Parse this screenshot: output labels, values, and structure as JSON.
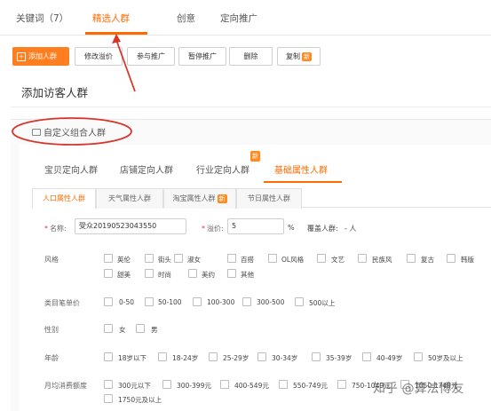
{
  "top_tabs": [
    {
      "label": "关键词（7）"
    },
    {
      "label": "精选人群"
    },
    {
      "label": "创意"
    },
    {
      "label": "定向推广"
    }
  ],
  "toolbar": {
    "add_label": "添加人群",
    "buttons": [
      "修改溢价",
      "参与推广",
      "暂停推广",
      "删除",
      "复制"
    ],
    "new_tag": "新"
  },
  "section_title": "添加访客人群",
  "custom_group_label": "自定义组合人群",
  "group_tabs": [
    "宝贝定向人群",
    "店铺定向人群",
    "行业定向人群",
    "基础属性人群"
  ],
  "group_tab_badge": "新",
  "sub_tabs": [
    "人口属性人群",
    "天气属性人群",
    "淘宝属性人群",
    "节日属性人群"
  ],
  "sub_tab_badge": "新",
  "form": {
    "name_label": "名称:",
    "name_value": "受众20190523043550",
    "premium_label": "溢价:",
    "premium_value": "5",
    "percent": "%",
    "coverage_label": "覆盖人群:",
    "coverage_value": "- 人"
  },
  "rows": {
    "style": {
      "label": "风格",
      "options": [
        "英伦",
        "街头",
        "淑女",
        "百搭",
        "OL风格",
        "文艺",
        "民族风",
        "复古",
        "韩版",
        "甜美",
        "时尚",
        "美约",
        "其他"
      ]
    },
    "price": {
      "label": "类目笔单价",
      "options": [
        "0-50",
        "50-100",
        "100-300",
        "300-500",
        "500以上"
      ]
    },
    "gender": {
      "label": "性别",
      "options": [
        "女",
        "男"
      ]
    },
    "age": {
      "label": "年龄",
      "options": [
        "18岁以下",
        "18-24岁",
        "25-29岁",
        "30-34岁",
        "35-39岁",
        "40-49岁",
        "50岁及以上"
      ]
    },
    "spend": {
      "label": "月均消费额度",
      "options": [
        "300元以下",
        "300-399元",
        "400-549元",
        "550-749元",
        "750-1049元",
        "1050-1749元",
        "1750元及以上"
      ]
    }
  },
  "watermark": "知乎 @算法博友",
  "colors": {
    "accent": "#ff6a00",
    "annotation": "#d9362b"
  }
}
